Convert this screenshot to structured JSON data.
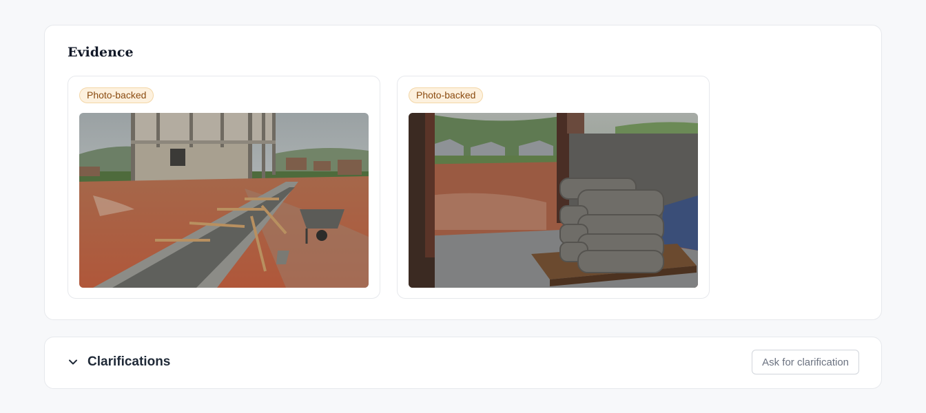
{
  "evidence": {
    "title": "Evidence",
    "cards": [
      {
        "badge": "Photo-backed",
        "image": "construction-site-trench-photo"
      },
      {
        "badge": "Photo-backed",
        "image": "cement-bags-on-pallet-photo"
      }
    ]
  },
  "clarifications": {
    "title": "Clarifications",
    "toggle_icon": "chevron-down-icon",
    "button_label": "Ask for clarification"
  },
  "colors": {
    "badge_bg": "#fdf1de",
    "badge_text": "#8a4b10",
    "page_bg": "#f7f8fa"
  }
}
